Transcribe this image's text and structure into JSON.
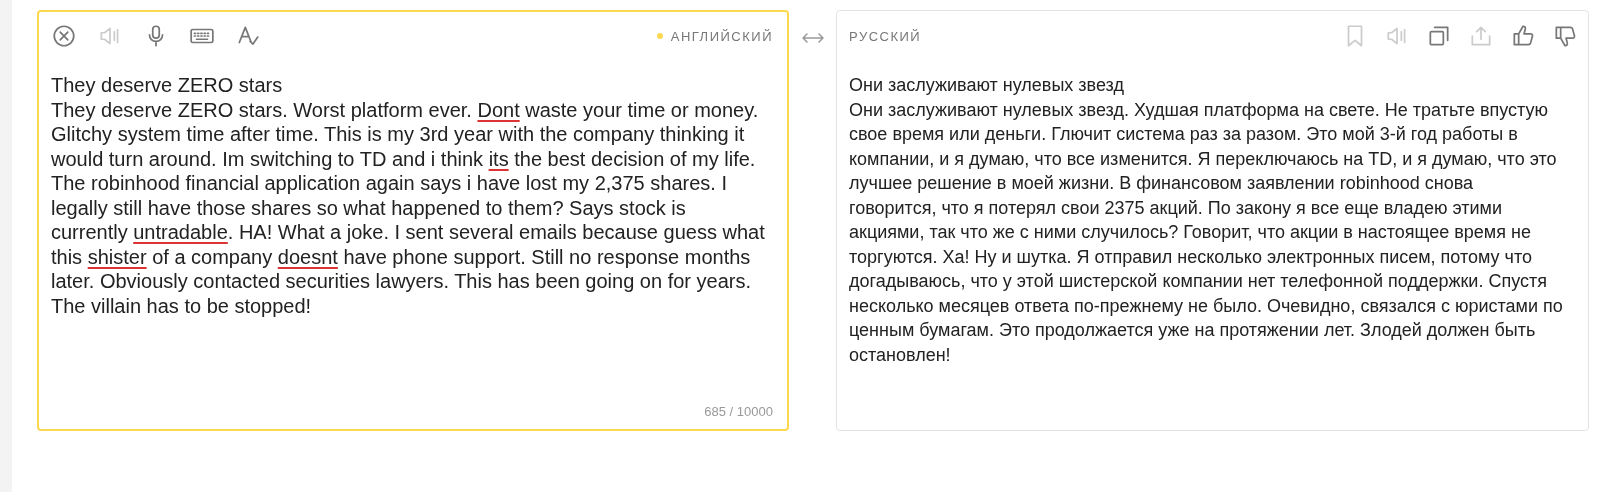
{
  "source": {
    "toolbar": [
      {
        "kind": "clear",
        "disabled": false
      },
      {
        "kind": "speak",
        "disabled": true
      },
      {
        "kind": "voice",
        "disabled": false
      },
      {
        "kind": "keyboard",
        "disabled": false
      },
      {
        "kind": "spellcheck",
        "disabled": false
      }
    ],
    "language": "АНГЛИЙСКИЙ",
    "paragraphs": [
      [
        {
          "text": "They deserve ZERO stars",
          "misspelled": false
        }
      ],
      [
        {
          "text": "They deserve ZERO stars. Worst platform ever. ",
          "misspelled": false
        },
        {
          "text": "Dont",
          "misspelled": true
        },
        {
          "text": " waste your time or money. Glitchy system time after time. This is my 3rd year with the company thinking it would turn around. Im switching to TD and i think ",
          "misspelled": false
        },
        {
          "text": "its",
          "misspelled": true
        },
        {
          "text": " the best decision of my life. The robinhood financial application again says i have lost my 2,375 shares. I legally still have those shares so what happened to them? Says stock is currently ",
          "misspelled": false
        },
        {
          "text": "untradable",
          "misspelled": true
        },
        {
          "text": ". HA! What a joke. I sent several emails because guess what this ",
          "misspelled": false
        },
        {
          "text": "shister",
          "misspelled": true
        },
        {
          "text": " of a company ",
          "misspelled": false
        },
        {
          "text": "doesnt",
          "misspelled": true
        },
        {
          "text": " have phone support. Still no response months later. Obviously contacted securities lawyers. This has been going on for years. The villain has to be stopped!",
          "misspelled": false
        }
      ]
    ],
    "counter": "685 / 10000"
  },
  "target": {
    "language": "РУССКИЙ",
    "toolbar": [
      {
        "kind": "bookmark",
        "disabled": true
      },
      {
        "kind": "speak",
        "disabled": true
      },
      {
        "kind": "copy",
        "disabled": false
      },
      {
        "kind": "share",
        "disabled": true
      },
      {
        "kind": "like",
        "disabled": false
      },
      {
        "kind": "dislike",
        "disabled": false
      }
    ],
    "paragraphs": [
      "Они заслуживают нулевых звезд",
      "Они заслуживают нулевых звезд. Худшая платформа на свете. Не тратьте впустую свое время или деньги. Глючит система раз за разом. Это мой 3-й год работы в компании, и я думаю, что все изменится. Я переключаюсь на TD, и я думаю, что это лучшее решение в моей жизни. В финансовом заявлении robinhood снова говорится, что я потерял свои 2375 акций. По закону я все еще владею этими акциями, так что же с ними случилось? Говорит, что акции в настоящее время не торгуются. Ха! Ну и шутка. Я отправил несколько электронных писем, потому что догадываюсь, что у этой шистерской компании нет телефонной поддержки. Спустя несколько месяцев ответа по-прежнему не было. Очевидно, связался с юристами по ценным бумагам. Это продолжается уже на протяжении лет. Злодей должен быть остановлен!"
    ]
  }
}
